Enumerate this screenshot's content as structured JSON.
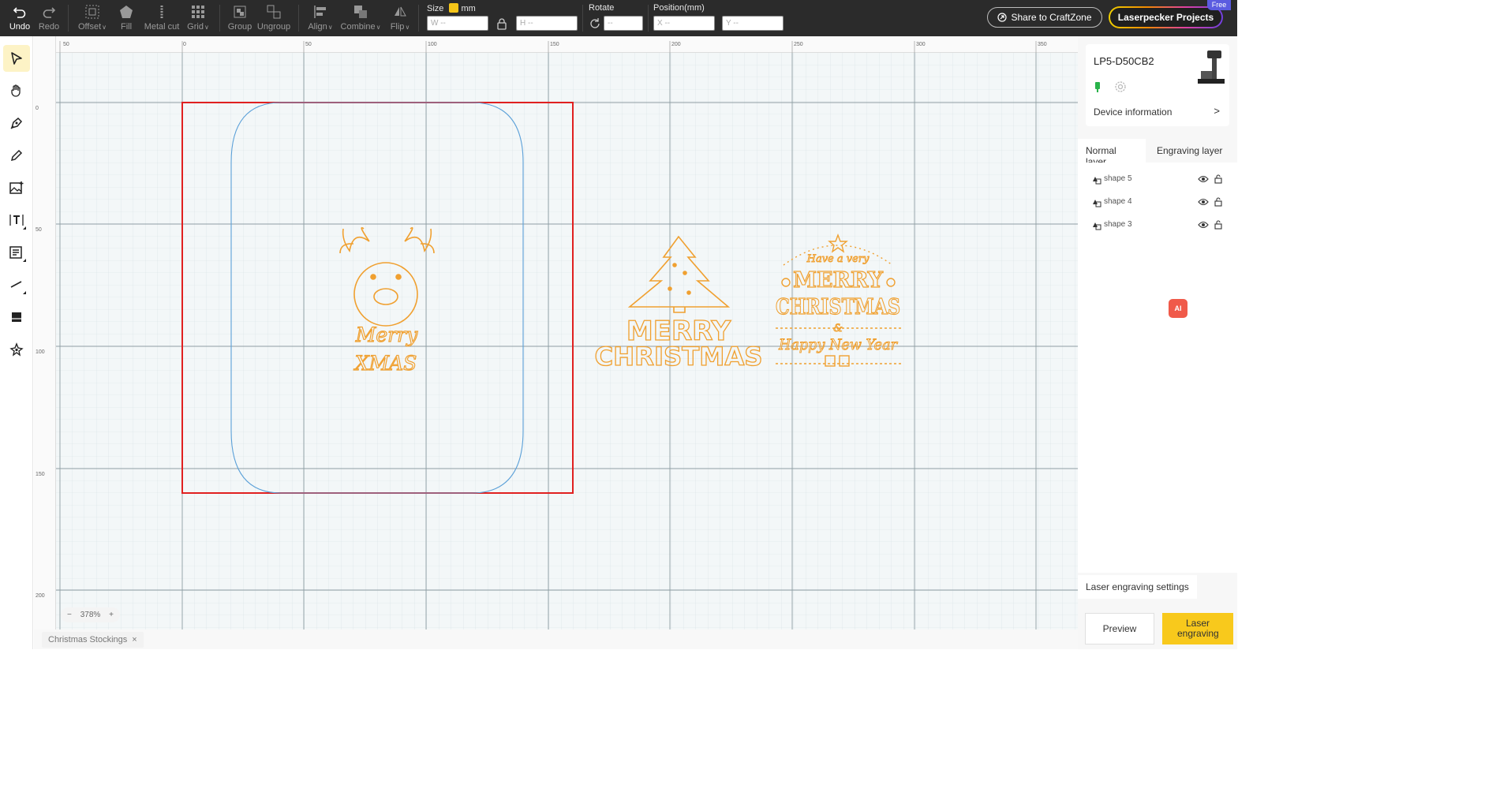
{
  "toolbar": {
    "undo": "Undo",
    "redo": "Redo",
    "offset": "Offset",
    "fill": "Fill",
    "metal_cut": "Metal cut",
    "grid": "Grid",
    "group": "Group",
    "ungroup": "Ungroup",
    "align": "Align",
    "combine": "Combine",
    "flip": "Flip",
    "size_label": "Size",
    "size_unit": "mm",
    "w_placeholder": "W --",
    "h_placeholder": "H --",
    "rotate_label": "Rotate",
    "rotate_placeholder": "--",
    "position_label": "Position(mm)",
    "x_placeholder": "X --",
    "y_placeholder": "Y --",
    "share_label": "Share to CraftZone",
    "projects_label": "Laserpecker Projects",
    "free_badge": "Free"
  },
  "rulers": {
    "top": [
      "50",
      "0",
      "50",
      "100",
      "150",
      "200",
      "250",
      "300",
      "350"
    ],
    "left": [
      "0",
      "50",
      "100",
      "150",
      "200"
    ]
  },
  "canvas": {
    "zoom": "378%",
    "zoom_minus": "−",
    "zoom_plus": "+",
    "design1_line1": "Merry",
    "design1_line2": "XMAS",
    "design2_line1": "MERRY",
    "design2_line2": "CHRISTMAS",
    "design3_line1": "Have a very",
    "design3_line2": "MERRY",
    "design3_line3": "CHRISTMAS",
    "design3_line4": "&",
    "design3_line5": "Happy New Year"
  },
  "doc_tab": {
    "name": "Christmas Stockings",
    "close": "×"
  },
  "device": {
    "name": "LP5-D50CB2",
    "info_label": "Device information",
    "chevron": ">"
  },
  "layer_tabs": [
    "Normal layer",
    "Engraving layer"
  ],
  "layers": [
    {
      "name": "shape 5"
    },
    {
      "name": "shape 4"
    },
    {
      "name": "shape 3"
    }
  ],
  "ai_label": "AI",
  "engraving_settings_label": "Laser engraving settings",
  "preview_label": "Preview",
  "laser_engraving_label": "Laser engraving",
  "colors": {
    "accent_yellow": "#f8c91c",
    "design_orange": "#f0a030",
    "bed_red": "#e02020",
    "stocking_blue": "#5ba0d8"
  }
}
